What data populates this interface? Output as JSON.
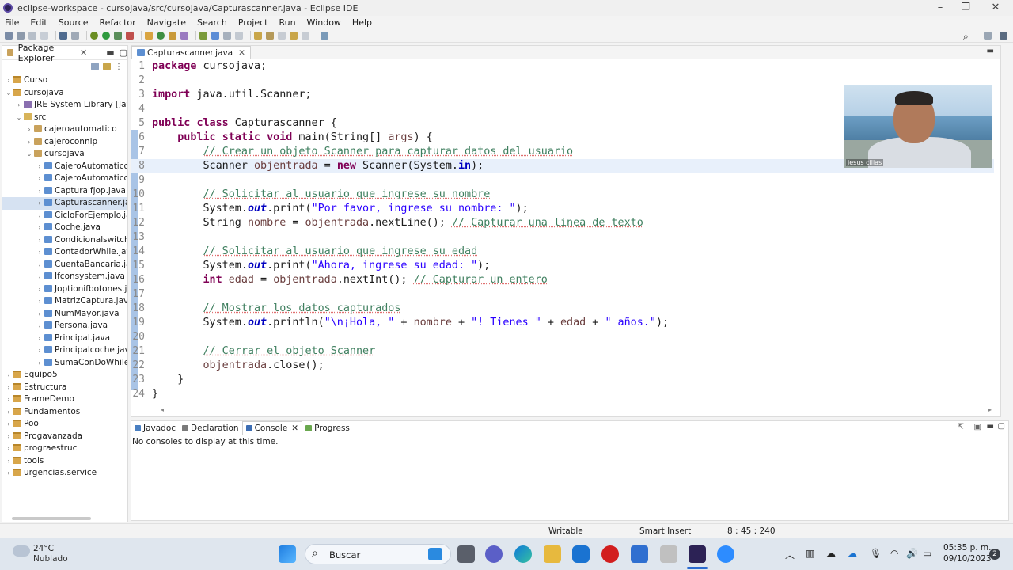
{
  "window": {
    "title": "eclipse-workspace - cursojava/src/cursojava/Capturascanner.java - Eclipse IDE"
  },
  "menu": [
    "File",
    "Edit",
    "Source",
    "Refactor",
    "Navigate",
    "Search",
    "Project",
    "Run",
    "Window",
    "Help"
  ],
  "package_explorer": {
    "title": "Package Explorer",
    "tree": [
      {
        "label": "Curso",
        "indent": 0,
        "toggle": ">",
        "icon": "proj"
      },
      {
        "label": "cursojava",
        "indent": 0,
        "toggle": "v",
        "icon": "proj"
      },
      {
        "label": "JRE System Library [JavaSE-",
        "indent": 1,
        "toggle": ">",
        "icon": "jre"
      },
      {
        "label": "src",
        "indent": 1,
        "toggle": "v",
        "icon": "srcf"
      },
      {
        "label": "cajeroautomatico",
        "indent": 2,
        "toggle": ">",
        "icon": "pkg-i"
      },
      {
        "label": "cajeroconnip",
        "indent": 2,
        "toggle": ">",
        "icon": "pkg-i"
      },
      {
        "label": "cursojava",
        "indent": 2,
        "toggle": "v",
        "icon": "pkg-i"
      },
      {
        "label": "CajeroAutomatico.jav",
        "indent": 3,
        "toggle": ">",
        "icon": "java"
      },
      {
        "label": "CajeroAutomaticoCo",
        "indent": 3,
        "toggle": ">",
        "icon": "java"
      },
      {
        "label": "Capturaifjop.java",
        "indent": 3,
        "toggle": ">",
        "icon": "java"
      },
      {
        "label": "Capturascanner.java",
        "indent": 3,
        "toggle": ">",
        "icon": "java",
        "selected": true
      },
      {
        "label": "CicloForEjemplo.java",
        "indent": 3,
        "toggle": ">",
        "icon": "java"
      },
      {
        "label": "Coche.java",
        "indent": 3,
        "toggle": ">",
        "icon": "java"
      },
      {
        "label": "Condicionalswitch.jav",
        "indent": 3,
        "toggle": ">",
        "icon": "java"
      },
      {
        "label": "ContadorWhile.java",
        "indent": 3,
        "toggle": ">",
        "icon": "java"
      },
      {
        "label": "CuentaBancaria.java",
        "indent": 3,
        "toggle": ">",
        "icon": "java"
      },
      {
        "label": "Ifconsystem.java",
        "indent": 3,
        "toggle": ">",
        "icon": "java"
      },
      {
        "label": "Joptionifbotones.java",
        "indent": 3,
        "toggle": ">",
        "icon": "java"
      },
      {
        "label": "MatrizCaptura.java",
        "indent": 3,
        "toggle": ">",
        "icon": "java"
      },
      {
        "label": "NumMayor.java",
        "indent": 3,
        "toggle": ">",
        "icon": "java"
      },
      {
        "label": "Persona.java",
        "indent": 3,
        "toggle": ">",
        "icon": "java"
      },
      {
        "label": "Principal.java",
        "indent": 3,
        "toggle": ">",
        "icon": "java"
      },
      {
        "label": "Principalcoche.java",
        "indent": 3,
        "toggle": ">",
        "icon": "java"
      },
      {
        "label": "SumaConDoWhile.jav",
        "indent": 3,
        "toggle": ">",
        "icon": "java"
      },
      {
        "label": "Equipo5",
        "indent": 0,
        "toggle": ">",
        "icon": "proj"
      },
      {
        "label": "Estructura",
        "indent": 0,
        "toggle": ">",
        "icon": "proj"
      },
      {
        "label": "FrameDemo",
        "indent": 0,
        "toggle": ">",
        "icon": "proj"
      },
      {
        "label": "Fundamentos",
        "indent": 0,
        "toggle": ">",
        "icon": "proj"
      },
      {
        "label": "Poo",
        "indent": 0,
        "toggle": ">",
        "icon": "proj"
      },
      {
        "label": "Progavanzada",
        "indent": 0,
        "toggle": ">",
        "icon": "proj"
      },
      {
        "label": "prograestruc",
        "indent": 0,
        "toggle": ">",
        "icon": "proj"
      },
      {
        "label": "tools",
        "indent": 0,
        "toggle": ">",
        "icon": "proj"
      },
      {
        "label": "urgencias.service",
        "indent": 0,
        "toggle": ">",
        "icon": "proj"
      }
    ]
  },
  "editor": {
    "tab_label": "Capturascanner.java",
    "current_line": 8,
    "lines": [
      [
        {
          "t": "package",
          "c": "kw"
        },
        {
          "t": " cursojava;"
        }
      ],
      [],
      [
        {
          "t": "import",
          "c": "kw"
        },
        {
          "t": " java.util.Scanner;"
        }
      ],
      [],
      [
        {
          "t": "public",
          "c": "kw"
        },
        {
          "t": " "
        },
        {
          "t": "class",
          "c": "kw"
        },
        {
          "t": " Capturascanner {"
        }
      ],
      [
        {
          "t": "    "
        },
        {
          "t": "public",
          "c": "kw"
        },
        {
          "t": " "
        },
        {
          "t": "static",
          "c": "kw"
        },
        {
          "t": " "
        },
        {
          "t": "void",
          "c": "kw"
        },
        {
          "t": " main(String[] "
        },
        {
          "t": "args",
          "c": "var"
        },
        {
          "t": ") {"
        }
      ],
      [
        {
          "t": "        "
        },
        {
          "t": "// Crear un objeto Scanner para capturar datos del usuario",
          "c": "cm"
        }
      ],
      [
        {
          "t": "        Scanner "
        },
        {
          "t": "objentrada",
          "c": "var"
        },
        {
          "t": " = "
        },
        {
          "t": "new",
          "c": "kw"
        },
        {
          "t": " Scanner(System."
        },
        {
          "t": "in",
          "c": "fldi"
        },
        {
          "t": ");"
        }
      ],
      [],
      [
        {
          "t": "        "
        },
        {
          "t": "// Solicitar al usuario que ingrese su nombre",
          "c": "cm"
        }
      ],
      [
        {
          "t": "        System."
        },
        {
          "t": "out",
          "c": "fld"
        },
        {
          "t": ".print("
        },
        {
          "t": "\"Por favor, ingrese su nombre: \"",
          "c": "str"
        },
        {
          "t": ");"
        }
      ],
      [
        {
          "t": "        String "
        },
        {
          "t": "nombre",
          "c": "var"
        },
        {
          "t": " = "
        },
        {
          "t": "objentrada",
          "c": "var"
        },
        {
          "t": ".nextLine(); "
        },
        {
          "t": "// Capturar una linea de texto",
          "c": "cm"
        }
      ],
      [],
      [
        {
          "t": "        "
        },
        {
          "t": "// Solicitar al usuario que ingrese su edad",
          "c": "cm"
        }
      ],
      [
        {
          "t": "        System."
        },
        {
          "t": "out",
          "c": "fld"
        },
        {
          "t": ".print("
        },
        {
          "t": "\"Ahora, ingrese su edad: \"",
          "c": "str"
        },
        {
          "t": ");"
        }
      ],
      [
        {
          "t": "        "
        },
        {
          "t": "int",
          "c": "kw"
        },
        {
          "t": " "
        },
        {
          "t": "edad",
          "c": "var"
        },
        {
          "t": " = "
        },
        {
          "t": "objentrada",
          "c": "var"
        },
        {
          "t": ".nextInt(); "
        },
        {
          "t": "// Capturar un entero",
          "c": "cm"
        }
      ],
      [],
      [
        {
          "t": "        "
        },
        {
          "t": "// Mostrar los datos capturados",
          "c": "cm"
        }
      ],
      [
        {
          "t": "        System."
        },
        {
          "t": "out",
          "c": "fld"
        },
        {
          "t": ".println("
        },
        {
          "t": "\"\\n¡Hola, \"",
          "c": "str"
        },
        {
          "t": " + "
        },
        {
          "t": "nombre",
          "c": "var"
        },
        {
          "t": " + "
        },
        {
          "t": "\"! Tienes \"",
          "c": "str"
        },
        {
          "t": " + "
        },
        {
          "t": "edad",
          "c": "var"
        },
        {
          "t": " + "
        },
        {
          "t": "\" años.\"",
          "c": "str"
        },
        {
          "t": ");"
        }
      ],
      [],
      [
        {
          "t": "        "
        },
        {
          "t": "// Cerrar el objeto Scanner",
          "c": "cm"
        }
      ],
      [
        {
          "t": "        "
        },
        {
          "t": "objentrada",
          "c": "var"
        },
        {
          "t": ".close();"
        }
      ],
      [
        {
          "t": "    }"
        }
      ],
      [
        {
          "t": "}"
        }
      ]
    ]
  },
  "webcam": {
    "name": "jesus cilias"
  },
  "console": {
    "tabs": [
      {
        "label": "Javadoc",
        "color": "#4a7fc1"
      },
      {
        "label": "Declaration",
        "color": "#7a7a7a"
      },
      {
        "label": "Console",
        "color": "#3c6db3",
        "active": true
      },
      {
        "label": "Progress",
        "color": "#6aa84f"
      }
    ],
    "message": "No consoles to display at this time."
  },
  "status": {
    "writable": "Writable",
    "insert_mode": "Smart Insert",
    "position": "8 : 45 : 240"
  },
  "taskbar": {
    "temperature": "24°C",
    "weather": "Nublado",
    "search_placeholder": "Buscar",
    "time": "05:35 p. m.",
    "date": "09/10/2023",
    "notifications": "2"
  }
}
